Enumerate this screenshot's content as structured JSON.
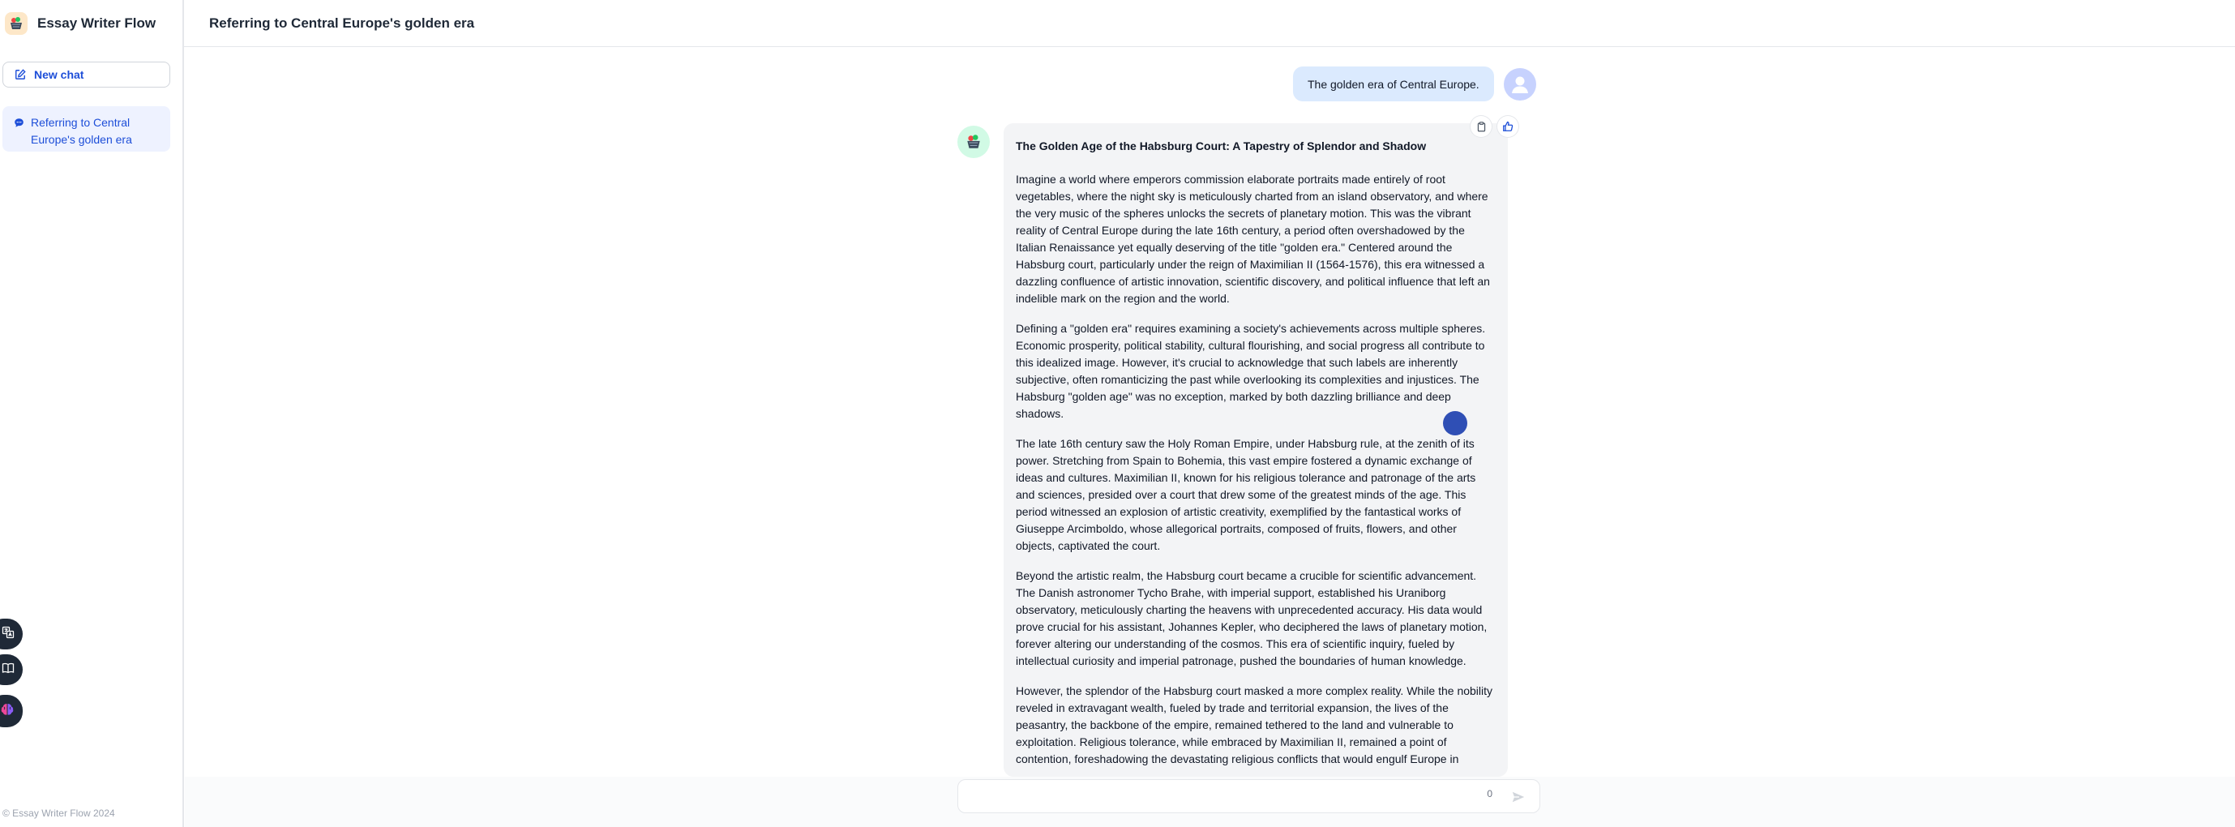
{
  "app": {
    "name": "Essay Writer Flow"
  },
  "sidebar": {
    "new_chat_label": "New chat",
    "conversations": [
      {
        "label": "Referring to Central Europe's golden era"
      }
    ],
    "footer": "© Essay Writer Flow 2024"
  },
  "header": {
    "title": "Referring to Central Europe's golden era"
  },
  "chat": {
    "user_message": "The golden era of Central Europe.",
    "assistant": {
      "title": "The Golden Age of the Habsburg Court: A Tapestry of Splendor and Shadow",
      "paragraphs": [
        "Imagine a world where emperors commission elaborate portraits made entirely of root vegetables, where the night sky is meticulously charted from an island observatory, and where the very music of the spheres unlocks the secrets of planetary motion. This was the vibrant reality of Central Europe during the late 16th century, a period often overshadowed by the Italian Renaissance yet equally deserving of the title \"golden era.\" Centered around the Habsburg court, particularly under the reign of Maximilian II (1564-1576), this era witnessed a dazzling confluence of artistic innovation, scientific discovery, and political influence that left an indelible mark on the region and the world.",
        "Defining a \"golden era\" requires examining a society's achievements across multiple spheres. Economic prosperity, political stability, cultural flourishing, and social progress all contribute to this idealized image. However, it's crucial to acknowledge that such labels are inherently subjective, often romanticizing the past while overlooking its complexities and injustices. The Habsburg \"golden age\" was no exception, marked by both dazzling brilliance and deep shadows.",
        "The late 16th century saw the Holy Roman Empire, under Habsburg rule, at the zenith of its power. Stretching from Spain to Bohemia, this vast empire fostered a dynamic exchange of ideas and cultures. Maximilian II, known for his religious tolerance and patronage of the arts and sciences, presided over a court that drew some of the greatest minds of the age. This period witnessed an explosion of artistic creativity, exemplified by the fantastical works of Giuseppe Arcimboldo, whose allegorical portraits, composed of fruits, flowers, and other objects, captivated the court.",
        "Beyond the artistic realm, the Habsburg court became a crucible for scientific advancement. The Danish astronomer Tycho Brahe, with imperial support, established his Uraniborg observatory, meticulously charting the heavens with unprecedented accuracy. His data would prove crucial for his assistant, Johannes Kepler, who deciphered the laws of planetary motion, forever altering our understanding of the cosmos. This era of scientific inquiry, fueled by intellectual curiosity and imperial patronage, pushed the boundaries of human knowledge.",
        "However, the splendor of the Habsburg court masked a more complex reality. While the nobility reveled in extravagant wealth, fueled by trade and territorial expansion, the lives of the peasantry, the backbone of the empire, remained tethered to the land and vulnerable to exploitation. Religious tolerance, while embraced by Maximilian II, remained a point of contention, foreshadowing the devastating religious conflicts that would engulf Europe in"
      ]
    }
  },
  "input": {
    "value": "",
    "char_count": "0"
  },
  "icons": {
    "brand": "basket-logo-icon",
    "new_chat": "edit-icon",
    "conversation": "chat-bubble-icon",
    "copy": "clipboard-icon",
    "like": "thumbs-up-icon",
    "send": "send-icon",
    "dock": [
      "translate-icon",
      "book-icon",
      "brain-icon"
    ]
  },
  "colors": {
    "accent": "#1d4ed8",
    "user_bubble": "#dbeafe",
    "assistant_bubble": "#f3f4f6"
  }
}
